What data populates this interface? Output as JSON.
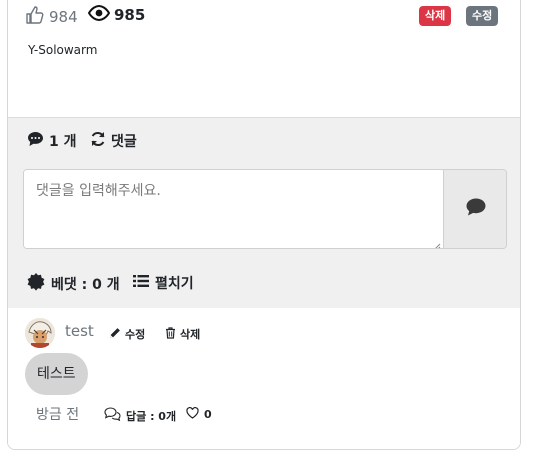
{
  "post": {
    "like_count": "984",
    "view_count": "985",
    "delete_badge": "삭제",
    "edit_badge": "수정",
    "content": "Y-Solowarm"
  },
  "comments": {
    "count_label": "1 개",
    "refresh_label": "댓글",
    "input_placeholder": "댓글을 입력해주세요.",
    "input_value": "",
    "best_label": "베댓 : 0 개",
    "expand_label": "펼치기"
  },
  "reply": {
    "username": "test",
    "edit_label": "수정",
    "delete_label": "삭제",
    "text": "테스트",
    "time": "방금 전",
    "replies_label": "답글 : 0개",
    "like_count": "0"
  },
  "colors": {
    "danger": "#dc3545",
    "secondary": "#6c757d",
    "comment_bg": "#f0f0f0",
    "bubble_bg": "#d4d4d4"
  },
  "icons": [
    "thumbs-up-icon",
    "eye-icon",
    "comment-dots-icon",
    "refresh-icon",
    "chat-bubble-icon",
    "certificate-icon",
    "list-icon",
    "pencil-icon",
    "trash-icon",
    "comments-icon",
    "heart-icon"
  ]
}
